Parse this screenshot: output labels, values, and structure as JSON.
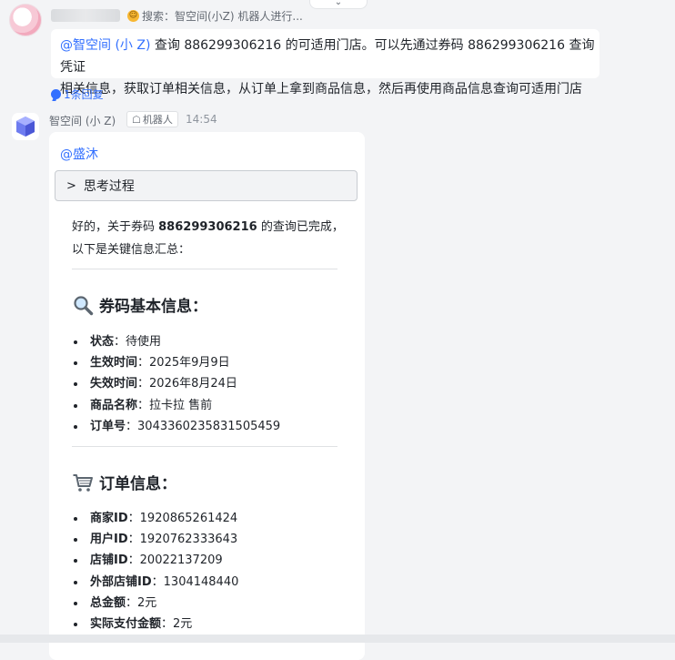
{
  "thread": {
    "status_text": "搜索：智空间(小Z) 机器人进行...",
    "message": {
      "mention": "@智空间 (小 Z)",
      "body_line1": "  查询 886299306216 的可适用门店。可以先通过券码 886299306216 查询凭证",
      "body_line2": "相关信息，获取订单相关信息，从订单上拿到商品信息，然后再使用商品信息查询可适用门店"
    },
    "reply_count": "1条回复"
  },
  "bot": {
    "name": "智空间 (小 Z)",
    "tag": "机器人",
    "time": "14:54",
    "mention": "@盛沐",
    "thinking_label": "思考过程",
    "intro": {
      "pre": "好的，关于券码 ",
      "code": "886299306216",
      "post": " 的查询已完成，",
      "line2": "以下是关键信息汇总："
    },
    "section1": {
      "title": "券码基本信息：",
      "icon": "magnifier-icon",
      "items": [
        {
          "label": "状态",
          "value": "待使用"
        },
        {
          "label": "生效时间",
          "value": "2025年9月9日"
        },
        {
          "label": "失效时间",
          "value": "2026年8月24日"
        },
        {
          "label": "商品名称",
          "value": "拉卡拉 售前"
        },
        {
          "label": "订单号",
          "value": "3043360235831505459"
        }
      ]
    },
    "section2": {
      "title": "订单信息：",
      "icon": "shopping-cart-icon",
      "items": [
        {
          "label": "商家ID",
          "value": "1920865261424"
        },
        {
          "label": "用户ID",
          "value": "1920762333643"
        },
        {
          "label": "店铺ID",
          "value": "20022137209"
        },
        {
          "label": "外部店铺ID",
          "value": "1304148440"
        },
        {
          "label": "总金额",
          "value": "2元"
        },
        {
          "label": "实际支付金额",
          "value": "2元"
        }
      ]
    }
  },
  "colors": {
    "accent": "#3370ff",
    "background": "#f3f4f6",
    "text": "#1f2329",
    "muted": "#646a73"
  }
}
